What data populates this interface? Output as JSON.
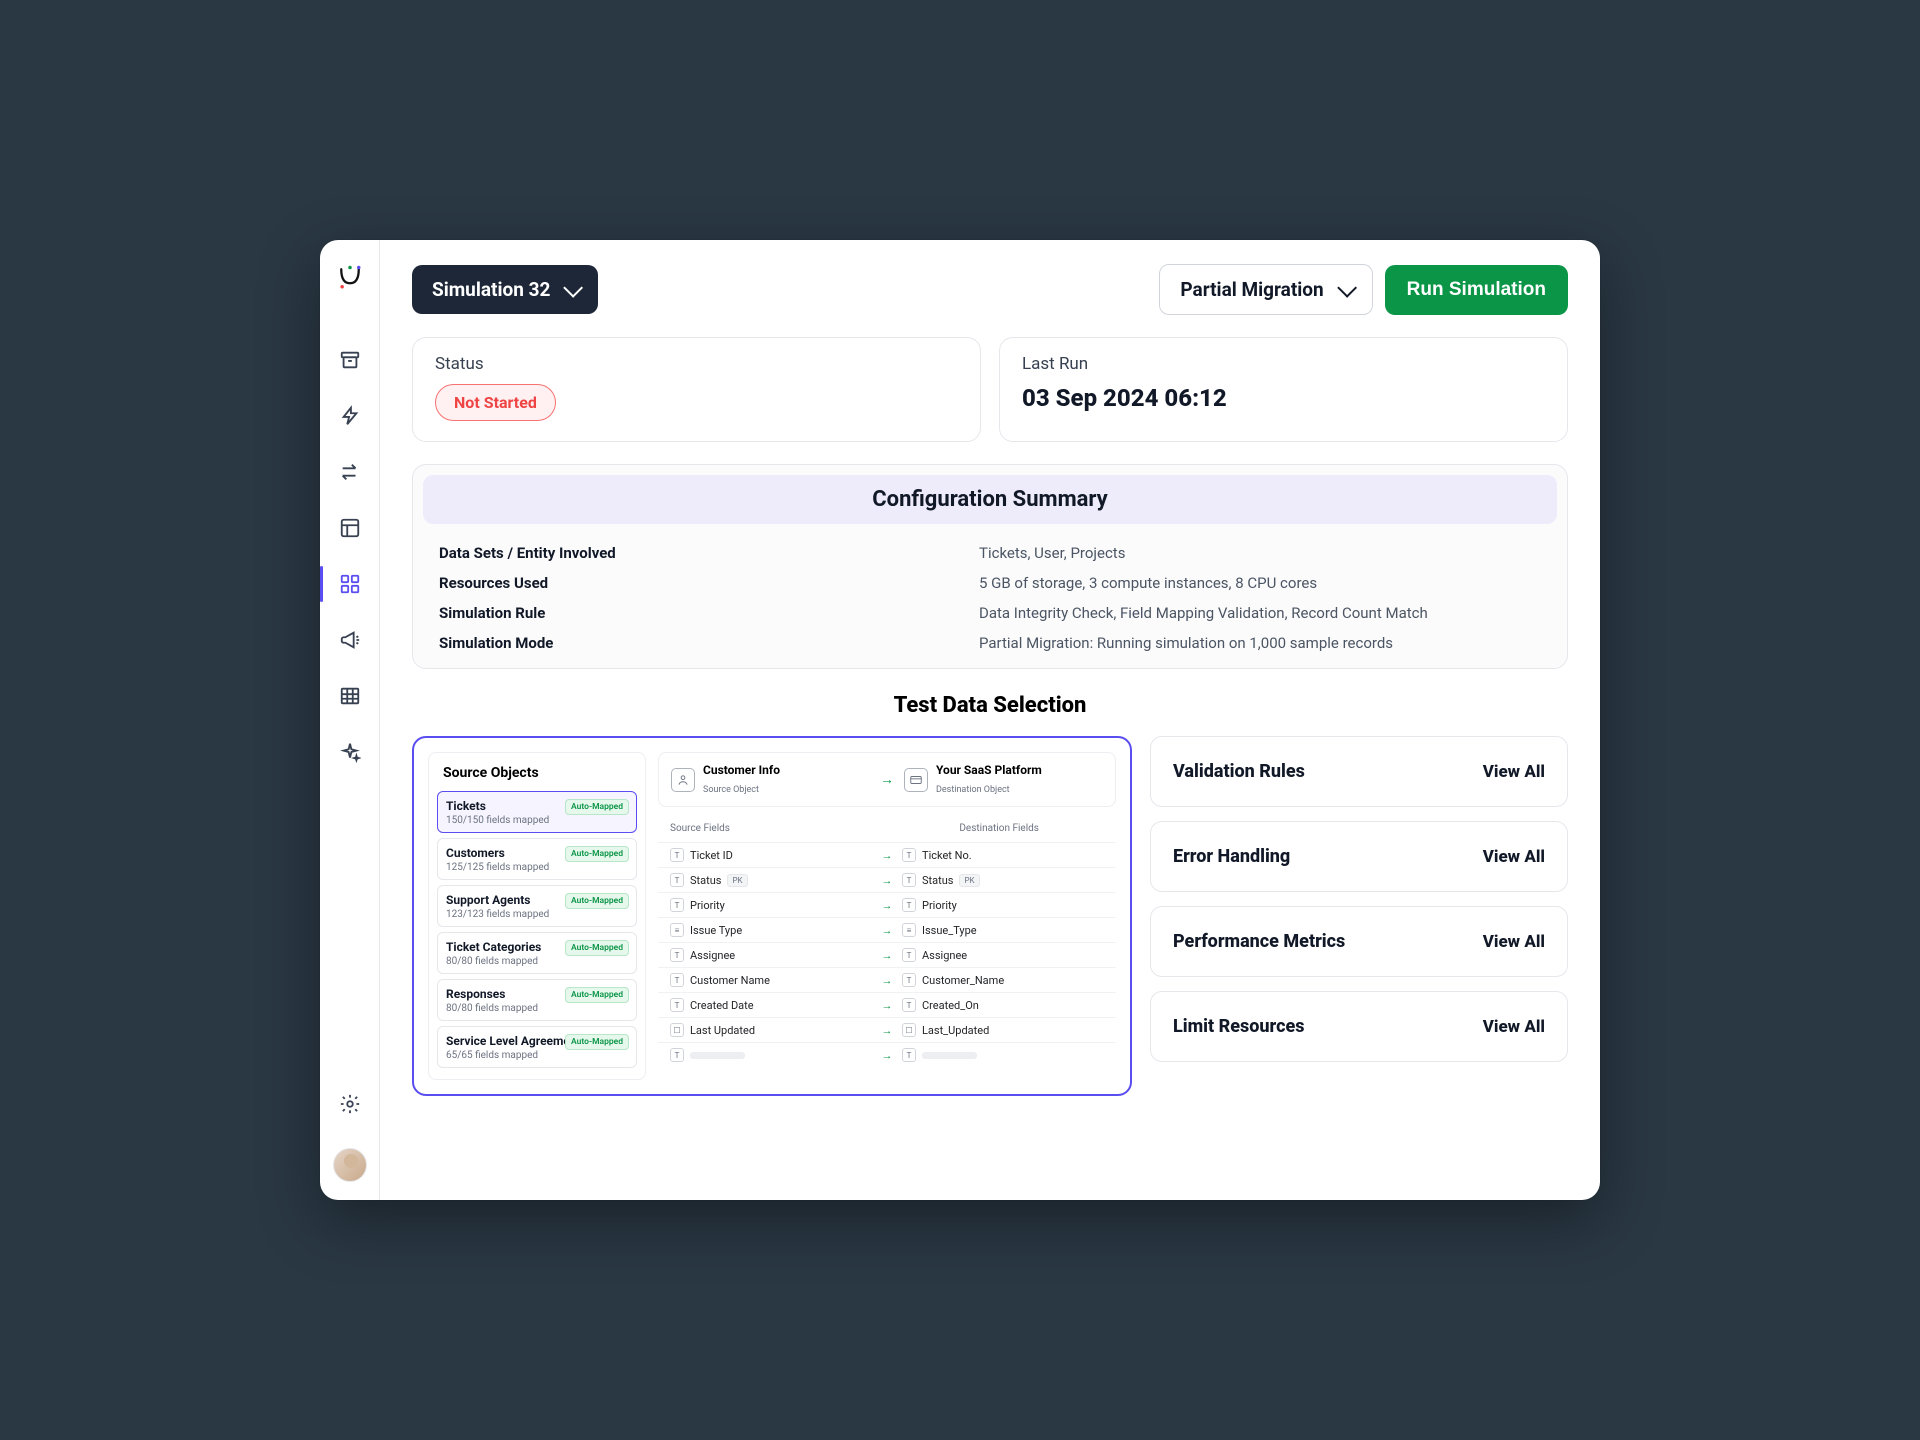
{
  "header": {
    "simulation_label": "Simulation 32",
    "mode_selected": "Partial Migration",
    "run_button": "Run Simulation"
  },
  "status": {
    "label": "Status",
    "value": "Not Started"
  },
  "last_run": {
    "label": "Last Run",
    "value": "03 Sep 2024 06:12"
  },
  "config": {
    "title": "Configuration Summary",
    "rows": [
      {
        "key": "Data Sets / Entity Involved",
        "val": "Tickets, User, Projects"
      },
      {
        "key": "Resources Used",
        "val": "5 GB of storage, 3 compute instances, 8 CPU cores"
      },
      {
        "key": "Simulation Rule",
        "val": "Data Integrity Check, Field Mapping Validation, Record Count Match"
      },
      {
        "key": "Simulation Mode",
        "val": "Partial Migration: Running simulation on 1,000 sample records"
      }
    ]
  },
  "test_section_title": "Test Data Selection",
  "source_objects": {
    "title": "Source Objects",
    "items": [
      {
        "name": "Tickets",
        "sub": "150/150 fields mapped",
        "badge": "Auto-Mapped",
        "selected": true
      },
      {
        "name": "Customers",
        "sub": "125/125 fields mapped",
        "badge": "Auto-Mapped"
      },
      {
        "name": "Support Agents",
        "sub": "123/123 fields mapped",
        "badge": "Auto-Mapped"
      },
      {
        "name": "Ticket Categories",
        "sub": "80/80 fields mapped",
        "badge": "Auto-Mapped"
      },
      {
        "name": "Responses",
        "sub": "80/80 fields mapped",
        "badge": "Auto-Mapped"
      },
      {
        "name": "Service Level Agreements",
        "sub": "65/65 fields mapped",
        "badge": "Auto-Mapped"
      }
    ]
  },
  "mapping": {
    "source": {
      "title": "Customer Info",
      "sub": "Source Object"
    },
    "dest": {
      "title": "Your SaaS Platform",
      "sub": "Destination Object"
    },
    "cols": {
      "source": "Source Fields",
      "dest": "Destination Fields"
    },
    "fields": [
      {
        "stype": "T",
        "sname": "Ticket ID",
        "dtype": "T",
        "dname": "Ticket No."
      },
      {
        "stype": "T",
        "sname": "Status",
        "spk": "PK",
        "dtype": "T",
        "dname": "Status",
        "dpk": "PK"
      },
      {
        "stype": "T",
        "sname": "Priority",
        "dtype": "T",
        "dname": "Priority"
      },
      {
        "stype": "≡",
        "sname": "Issue Type",
        "dtype": "≡",
        "dname": "Issue_Type"
      },
      {
        "stype": "T",
        "sname": "Assignee",
        "dtype": "T",
        "dname": "Assignee"
      },
      {
        "stype": "T",
        "sname": "Customer Name",
        "dtype": "T",
        "dname": "Customer_Name"
      },
      {
        "stype": "T",
        "sname": "Created Date",
        "dtype": "T",
        "dname": "Created_On"
      },
      {
        "stype": "☐",
        "sname": "Last Updated",
        "dtype": "☐",
        "dname": "Last_Updated"
      }
    ]
  },
  "side_cards": [
    {
      "title": "Validation Rules",
      "link": "View All"
    },
    {
      "title": "Error Handling",
      "link": "View All"
    },
    {
      "title": "Performance Metrics",
      "link": "View All"
    },
    {
      "title": "Limit Resources",
      "link": "View All"
    }
  ]
}
